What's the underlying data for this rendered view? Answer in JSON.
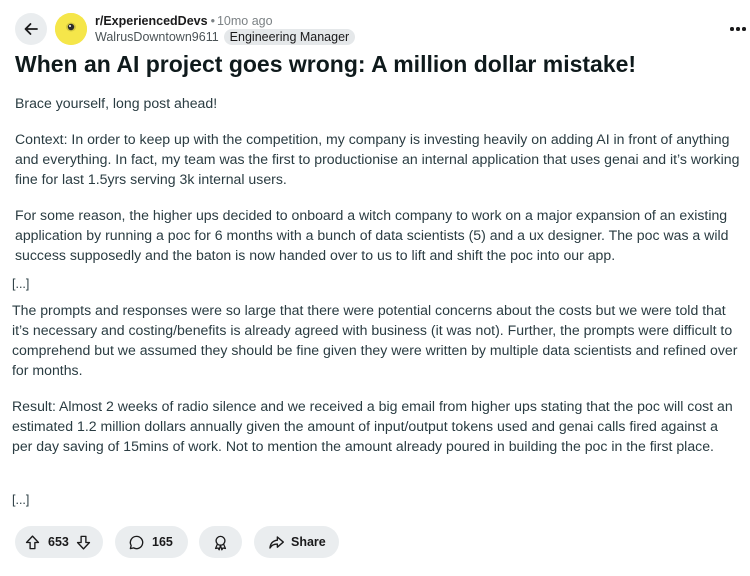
{
  "post": {
    "subreddit": "r/ExperiencedDevs",
    "separator": "•",
    "age": "10mo ago",
    "username": "WalrusDowntown9611",
    "flair": "Engineering Manager",
    "title": "When an AI project goes wrong: A million dollar mistake!",
    "paragraphs": [
      "Brace yourself, long post ahead!",
      "Context: In order to keep up with the competition, my company is investing heavily on adding AI in front of anything and everything. In fact, my team was the first to productionise an internal application that uses genai and it’s working fine for last 1.5yrs serving 3k internal users.",
      "For some reason, the higher ups decided to onboard a witch company to work on a major expansion of an existing application by running a poc for 6 months with a bunch of data scientists (5) and a ux designer. The poc was a wild success supposedly and the baton is now handed over to us to lift and shift the poc into our app.",
      "The prompts and responses were so large that there were potential concerns about the costs but we were told that it’s necessary and costing/benefits is already agreed with business (it was not). Further, the prompts were difficult to comprehend but we assumed they should be fine given they were written by multiple data scientists and refined over for months.",
      "Result: Almost 2 weeks of radio silence and we received a big email from higher ups stating that the poc will cost an estimated 1.2 million dollars annually given the amount of input/output tokens used and genai calls fired against a per day saving of 15mins of work. Not to mention the amount already poured in building the poc in the first place."
    ],
    "ellipsis_1": "[...]",
    "ellipsis_2": "[...]"
  },
  "actions": {
    "upvotes": "653",
    "comments": "165",
    "share_label": "Share"
  },
  "icons": {
    "back": "arrow-left-icon",
    "more": "more-horizontal-icon",
    "upvote": "upvote-arrow-icon",
    "downvote": "downvote-arrow-icon",
    "comment": "comment-bubble-icon",
    "award": "award-icon",
    "share": "share-arrow-icon"
  },
  "colors": {
    "avatar_bg": "#f5e64a",
    "pill_bg": "#eaedef",
    "text": "#1a1a1b",
    "muted": "#7c8285"
  }
}
